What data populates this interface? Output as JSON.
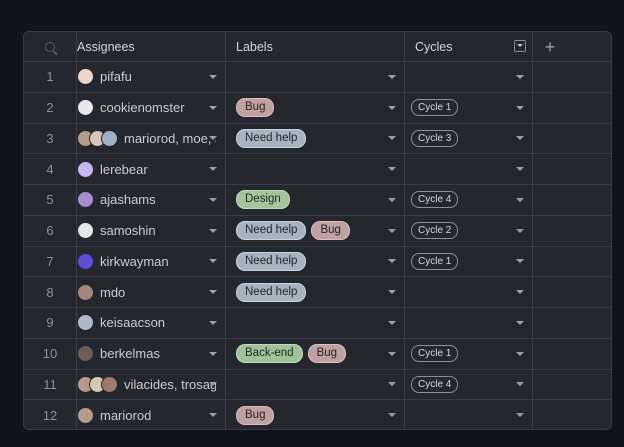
{
  "headers": {
    "assignees": "Assignees",
    "labels": "Labels",
    "cycles": "Cycles"
  },
  "rows": [
    {
      "num": "1",
      "assignees": "pifafu",
      "avatars": [
        "#f0d6c8"
      ],
      "labels": [],
      "cycle": ""
    },
    {
      "num": "2",
      "assignees": "cookienomster",
      "avatars": [
        "#e8e8e8"
      ],
      "labels": [
        {
          "text": "Bug",
          "kind": "bug"
        }
      ],
      "cycle": "Cycle 1"
    },
    {
      "num": "3",
      "assignees": "mariorod, moe, ar",
      "avatars": [
        "#b59c8a",
        "#d7c6b8",
        "#9fb1c0"
      ],
      "labels": [
        {
          "text": "Need help",
          "kind": "needhelp"
        }
      ],
      "cycle": "Cycle 3"
    },
    {
      "num": "4",
      "assignees": "lerebear",
      "avatars": [
        "#c9b6f0"
      ],
      "labels": [],
      "cycle": ""
    },
    {
      "num": "5",
      "assignees": "ajashams",
      "avatars": [
        "#a58bd1"
      ],
      "labels": [
        {
          "text": "Design",
          "kind": "design"
        }
      ],
      "cycle": "Cycle 4"
    },
    {
      "num": "6",
      "assignees": "samoshin",
      "avatars": [
        "#e4e6ea"
      ],
      "labels": [
        {
          "text": "Need help",
          "kind": "needhelp"
        },
        {
          "text": "Bug",
          "kind": "bug"
        }
      ],
      "cycle": "Cycle 2"
    },
    {
      "num": "7",
      "assignees": "kirkwayman",
      "avatars": [
        "#5b4fd6"
      ],
      "labels": [
        {
          "text": "Need help",
          "kind": "needhelp"
        }
      ],
      "cycle": "Cycle 1"
    },
    {
      "num": "8",
      "assignees": "mdo",
      "avatars": [
        "#a5867a"
      ],
      "labels": [
        {
          "text": "Need help",
          "kind": "needhelp"
        }
      ],
      "cycle": ""
    },
    {
      "num": "9",
      "assignees": "keisaacson",
      "avatars": [
        "#aeb8c6"
      ],
      "labels": [],
      "cycle": ""
    },
    {
      "num": "10",
      "assignees": "berkelmas",
      "avatars": [
        "#6c5e55"
      ],
      "labels": [
        {
          "text": "Back-end",
          "kind": "backend"
        },
        {
          "text": "Bug",
          "kind": "bug"
        }
      ],
      "cycle": "Cycle 1"
    },
    {
      "num": "11",
      "assignees": "vilacides, trosage",
      "avatars": [
        "#b89a88",
        "#d8c7b7",
        "#9a7b6c"
      ],
      "labels": [],
      "cycle": "Cycle 4"
    },
    {
      "num": "12",
      "assignees": "mariorod",
      "avatars": [
        "#b59c8a"
      ],
      "labels": [
        {
          "text": "Bug",
          "kind": "bug"
        }
      ],
      "cycle": ""
    }
  ]
}
